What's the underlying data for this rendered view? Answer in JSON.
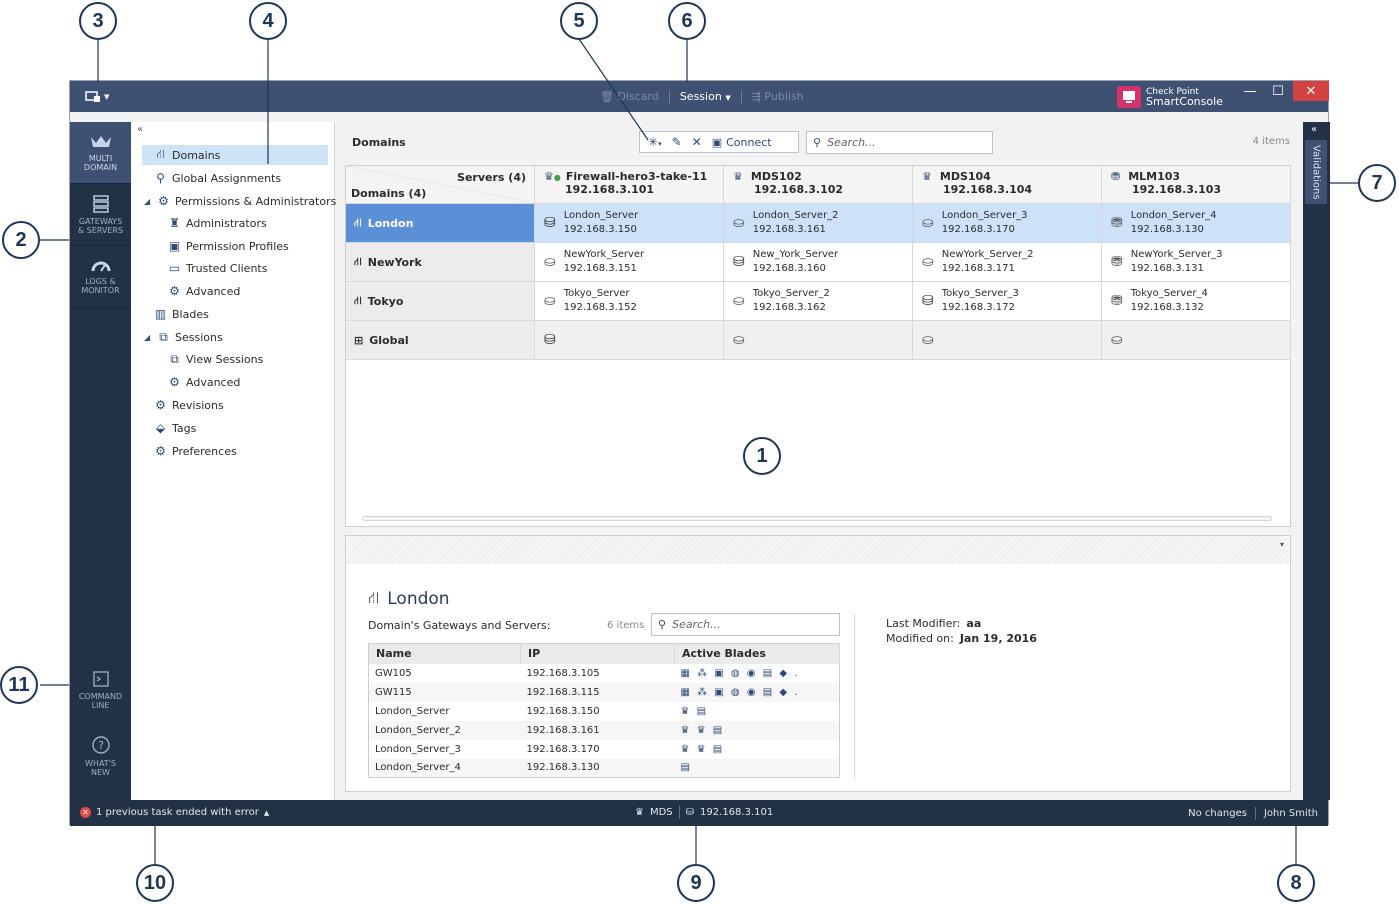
{
  "callouts": [
    "1",
    "2",
    "3",
    "4",
    "5",
    "6",
    "7",
    "8",
    "9",
    "10",
    "11"
  ],
  "titlebar": {
    "discard": "Discard",
    "session": "Session",
    "publish": "Publish",
    "brand_line1": "Check Point",
    "brand_line2": "SmartConsole"
  },
  "leftnav": {
    "multi_domain_1": "MULTI",
    "multi_domain_2": "DOMAIN",
    "gateways_1": "GATEWAYS",
    "gateways_2": "& SERVERS",
    "logs_1": "LOGS &",
    "logs_2": "MONITOR",
    "cmd_1": "COMMAND",
    "cmd_2": "LINE",
    "whats_1": "WHAT'S",
    "whats_2": "NEW"
  },
  "tree": [
    {
      "label": "Domains",
      "icon": "domains-icon"
    },
    {
      "label": "Global Assignments",
      "icon": "assignment-icon"
    },
    {
      "label": "Permissions & Administrators",
      "icon": "gear-icon"
    },
    {
      "label": "Administrators",
      "icon": "admin-icon"
    },
    {
      "label": "Permission Profiles",
      "icon": "profile-icon"
    },
    {
      "label": "Trusted Clients",
      "icon": "monitor-icon"
    },
    {
      "label": "Advanced",
      "icon": "gear-icon"
    },
    {
      "label": "Blades",
      "icon": "blades-icon"
    },
    {
      "label": "Sessions",
      "icon": "sessions-icon"
    },
    {
      "label": "View Sessions",
      "icon": "sessions-icon"
    },
    {
      "label": "Advanced",
      "icon": "gear-icon"
    },
    {
      "label": "Revisions",
      "icon": "gear-icon"
    },
    {
      "label": "Tags",
      "icon": "tag-icon"
    },
    {
      "label": "Preferences",
      "icon": "gear-icon"
    }
  ],
  "toolbar": {
    "title": "Domains",
    "connect": "Connect",
    "search_placeholder": "Search...",
    "count": "4 items"
  },
  "grid": {
    "servers_header": "Servers (4)",
    "domains_header": "Domains (4)",
    "columns": [
      {
        "name": "Firewall-hero3-take-11",
        "ip": "192.168.3.101"
      },
      {
        "name": "MDS102",
        "ip": "192.168.3.102"
      },
      {
        "name": "MDS104",
        "ip": "192.168.3.104"
      },
      {
        "name": "MLM103",
        "ip": "192.168.3.103"
      }
    ],
    "rows": [
      {
        "domain": "London",
        "cells": [
          {
            "name": "London_Server",
            "ip": "192.168.3.150"
          },
          {
            "name": "London_Server_2",
            "ip": "192.168.3.161"
          },
          {
            "name": "London_Server_3",
            "ip": "192.168.3.170"
          },
          {
            "name": "London_Server_4",
            "ip": "192.168.3.130"
          }
        ]
      },
      {
        "domain": "NewYork",
        "cells": [
          {
            "name": "NewYork_Server",
            "ip": "192.168.3.151"
          },
          {
            "name": "New_York_Server",
            "ip": "192.168.3.160"
          },
          {
            "name": "NewYork_Server_2",
            "ip": "192.168.3.171"
          },
          {
            "name": "NewYork_Server_3",
            "ip": "192.168.3.131"
          }
        ]
      },
      {
        "domain": "Tokyo",
        "cells": [
          {
            "name": "Tokyo_Server",
            "ip": "192.168.3.152"
          },
          {
            "name": "Tokyo_Server_2",
            "ip": "192.168.3.162"
          },
          {
            "name": "Tokyo_Server_3",
            "ip": "192.168.3.172"
          },
          {
            "name": "Tokyo_Server_4",
            "ip": "192.168.3.132"
          }
        ]
      },
      {
        "domain": "Global",
        "cells": [
          {
            "name": "",
            "ip": ""
          },
          {
            "name": "",
            "ip": ""
          },
          {
            "name": "",
            "ip": ""
          },
          {
            "name": "",
            "ip": ""
          }
        ]
      }
    ]
  },
  "details": {
    "name": "London",
    "subtitle": "Domain's Gateways and Servers:",
    "count": "6 items",
    "search_placeholder": "Search...",
    "headers": [
      "Name",
      "IP",
      "Active Blades"
    ],
    "rows": [
      {
        "name": "GW105",
        "ip": "192.168.3.105",
        "blades": "▦ ⁂ ▣ ◍ ◉ ▤ ◆ ."
      },
      {
        "name": "GW115",
        "ip": "192.168.3.115",
        "blades": "▦ ⁂ ▣ ◍ ◉ ▤ ◆ ."
      },
      {
        "name": "London_Server",
        "ip": "192.168.3.150",
        "blades": "♛ ▤"
      },
      {
        "name": "London_Server_2",
        "ip": "192.168.3.161",
        "blades": "♛ ♛ ▤"
      },
      {
        "name": "London_Server_3",
        "ip": "192.168.3.170",
        "blades": "♛ ♛ ▤"
      },
      {
        "name": "London_Server_4",
        "ip": "192.168.3.130",
        "blades": "▤"
      }
    ],
    "last_modifier_label": "Last Modifier:",
    "last_modifier": "aa",
    "modified_on_label": "Modified on:",
    "modified_on": "Jan 19, 2016"
  },
  "rightpanel": {
    "validations": "Validations"
  },
  "status": {
    "error": "1 previous task ended with error",
    "mds": "MDS",
    "ip": "192.168.3.101",
    "changes": "No changes",
    "user": "John Smith"
  }
}
